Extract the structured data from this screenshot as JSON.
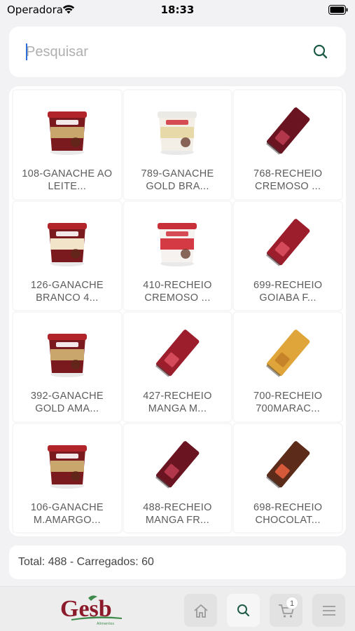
{
  "status_bar": {
    "carrier": "Operadora",
    "time": "18:33"
  },
  "search": {
    "placeholder": "Pesquisar"
  },
  "products": [
    {
      "line1": "108-GANACHE AO",
      "line2": "LEITE...",
      "kind": "bucket-melken"
    },
    {
      "line1": "789-GANACHE",
      "line2": "GOLD BRA...",
      "kind": "bucket-white"
    },
    {
      "line1": "768-RECHEIO",
      "line2": "CREMOSO ...",
      "kind": "pouch-dark"
    },
    {
      "line1": "126-GANACHE",
      "line2": "BRANCO 4...",
      "kind": "bucket-melken-cream"
    },
    {
      "line1": "410-RECHEIO",
      "line2": "CREMOSO ...",
      "kind": "bucket-red"
    },
    {
      "line1": "699-RECHEIO",
      "line2": "GOIABA F...",
      "kind": "pouch-red"
    },
    {
      "line1": "392-GANACHE",
      "line2": "GOLD AMA...",
      "kind": "bucket-melken"
    },
    {
      "line1": "427-RECHEIO",
      "line2": "MANGA M...",
      "kind": "pouch-red"
    },
    {
      "line1": "700-RECHEIO",
      "line2": "700MARAC...",
      "kind": "pouch-yellow"
    },
    {
      "line1": "106-GANACHE",
      "line2": "M.AMARGO...",
      "kind": "bucket-melken"
    },
    {
      "line1": "488-RECHEIO",
      "line2": "MANGA FR...",
      "kind": "pouch-dark"
    },
    {
      "line1": "698-RECHEIO",
      "line2": "CHOCOLAT...",
      "kind": "pouch-brown"
    }
  ],
  "total_text": "Total: 488 - Carregados: 60",
  "nav": {
    "logo_text": "Gesb",
    "logo_sub": "Alimentos",
    "cart_count": "1"
  },
  "colors": {
    "accent": "#1e5b48",
    "logo_red": "#8b1a2a",
    "logo_green": "#3d8a4a",
    "caret": "#2f6fd9"
  }
}
